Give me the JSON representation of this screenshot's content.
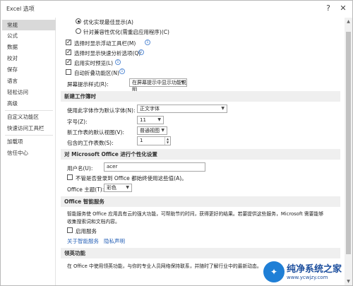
{
  "window": {
    "title": "Excel 选项",
    "help": "?",
    "close": "✕"
  },
  "sidebar": {
    "items": [
      {
        "label": "常规",
        "active": true
      },
      {
        "label": "公式"
      },
      {
        "label": "数据"
      },
      {
        "label": "校对"
      },
      {
        "label": "保存"
      },
      {
        "label": "语言"
      },
      {
        "label": "轻松访问"
      },
      {
        "label": "高级"
      },
      {
        "label": "自定义功能区"
      },
      {
        "label": "快速访问工具栏"
      },
      {
        "label": "加载项"
      },
      {
        "label": "信任中心"
      }
    ]
  },
  "ui_options": {
    "radio_best_display": "优化实现最佳显示(A)",
    "radio_compat": "针对兼容性优化(需重启应用程序)(C)",
    "mini_toolbar": "选择时显示浮动工具栏(M)",
    "quick_analysis": "选择时显示快速分析选项(Q)",
    "live_preview": "启用实时预览(L)",
    "collapse_ribbon": "自动折叠功能区(N)",
    "screentip_label": "屏幕提示样式(R):",
    "screentip_value": "在屏幕提示中显示功能说明",
    "info_glyph": "i",
    "check_glyph": "✓"
  },
  "new_workbook": {
    "header": "新建工作簿时",
    "font_label": "使用此字体作为默认字体(N):",
    "font_value": "正文字体",
    "size_label": "字号(Z):",
    "size_value": "11",
    "view_label": "新工作表的默认视图(V):",
    "view_value": "普通视图",
    "sheets_label": "包含的工作表数(S):",
    "sheets_value": "1"
  },
  "personalize": {
    "header": "对 Microsoft Office 进行个性化设置",
    "username_label": "用户名(U):",
    "username_value": "acer",
    "always_use": "不管是否登录到 Office 都始终使用这些值(A)。",
    "theme_label": "Office 主题(T):",
    "theme_value": "彩色"
  },
  "intelligent": {
    "header": "Office 智能服务",
    "desc_line1": "智能服务使 Office 应用具有云的强大功能，可帮助节约时间，获得更好的结果。若要提供这些服务，Microsoft 需要能够",
    "desc_line2": "收集搜索词和文档内容。",
    "enable": "启用服务",
    "about_link": "关于智能服务",
    "privacy_link": "隐私声明"
  },
  "linkedin": {
    "header": "领英功能",
    "desc": "在 Office 中使用领英功能，与你的专业人员网络保持联系，并随时了解行业中的最新动态。"
  },
  "watermark": {
    "logo": "✦",
    "text": "纯净系统之家",
    "sub": "www.ycwjzy.com"
  }
}
